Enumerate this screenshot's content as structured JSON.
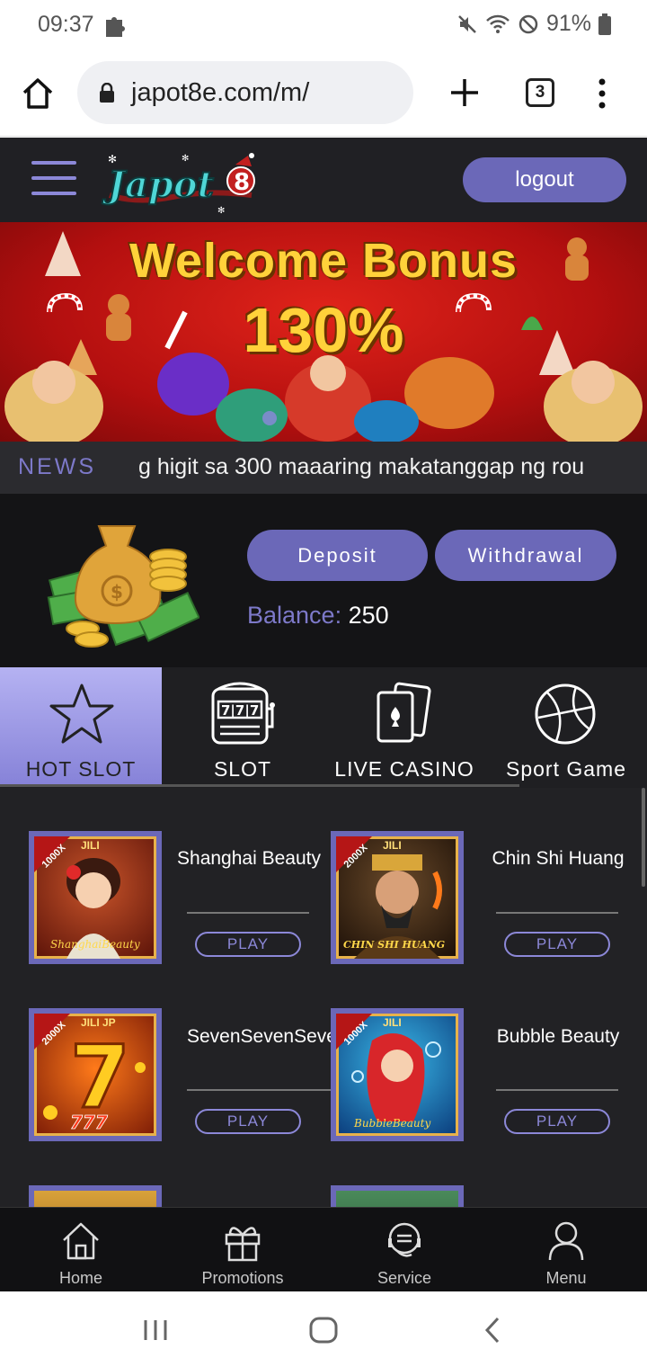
{
  "status_bar": {
    "time": "09:37",
    "battery": "91%"
  },
  "browser": {
    "url": "japot8e.com/m/",
    "tab_count": "3"
  },
  "header": {
    "logo_text": "Japot",
    "logout_label": "logout"
  },
  "banner": {
    "title": "Welcome Bonus",
    "percent": "130%"
  },
  "news": {
    "label": "NEWS",
    "text": "g higit  sa  300 maaaring makatanggap ng rou"
  },
  "wallet": {
    "deposit_label": "Deposit",
    "withdrawal_label": "Withdrawal",
    "balance_label": "Balance:",
    "balance_value": "250"
  },
  "categories": [
    {
      "label": "HOT SLOT",
      "icon": "star-icon",
      "active": true
    },
    {
      "label": "SLOT",
      "icon": "slot-machine-icon",
      "active": false
    },
    {
      "label": "LIVE CASINO",
      "icon": "playing-cards-icon",
      "active": false
    },
    {
      "label": "Sport Game",
      "icon": "basketball-icon",
      "active": false
    }
  ],
  "games": [
    {
      "name": "Shanghai Beauty",
      "badge": "1000X",
      "brand": "JILI",
      "art_text": "ShanghaiBeauty",
      "play_label": "PLAY"
    },
    {
      "name": "Chin Shi Huang",
      "badge": "2000X",
      "brand": "JILI",
      "art_text": "CHIN SHI HUANG",
      "play_label": "PLAY"
    },
    {
      "name": "SevenSevenSeve",
      "badge": "2000X",
      "brand": "JILI",
      "art_text": "777",
      "play_label": "PLAY"
    },
    {
      "name": "Bubble Beauty",
      "badge": "1000X",
      "brand": "JILI",
      "art_text": "BubbleBeauty",
      "play_label": "PLAY"
    }
  ],
  "bottom_nav": [
    {
      "label": "Home",
      "icon": "home-icon"
    },
    {
      "label": "Promotions",
      "icon": "gift-icon"
    },
    {
      "label": "Service",
      "icon": "chat-icon"
    },
    {
      "label": "Menu",
      "icon": "user-icon"
    }
  ],
  "colors": {
    "accent": "#6b68b8",
    "header_bg": "#202024",
    "banner_red": "#d01c16",
    "gold": "#ffd23a"
  }
}
